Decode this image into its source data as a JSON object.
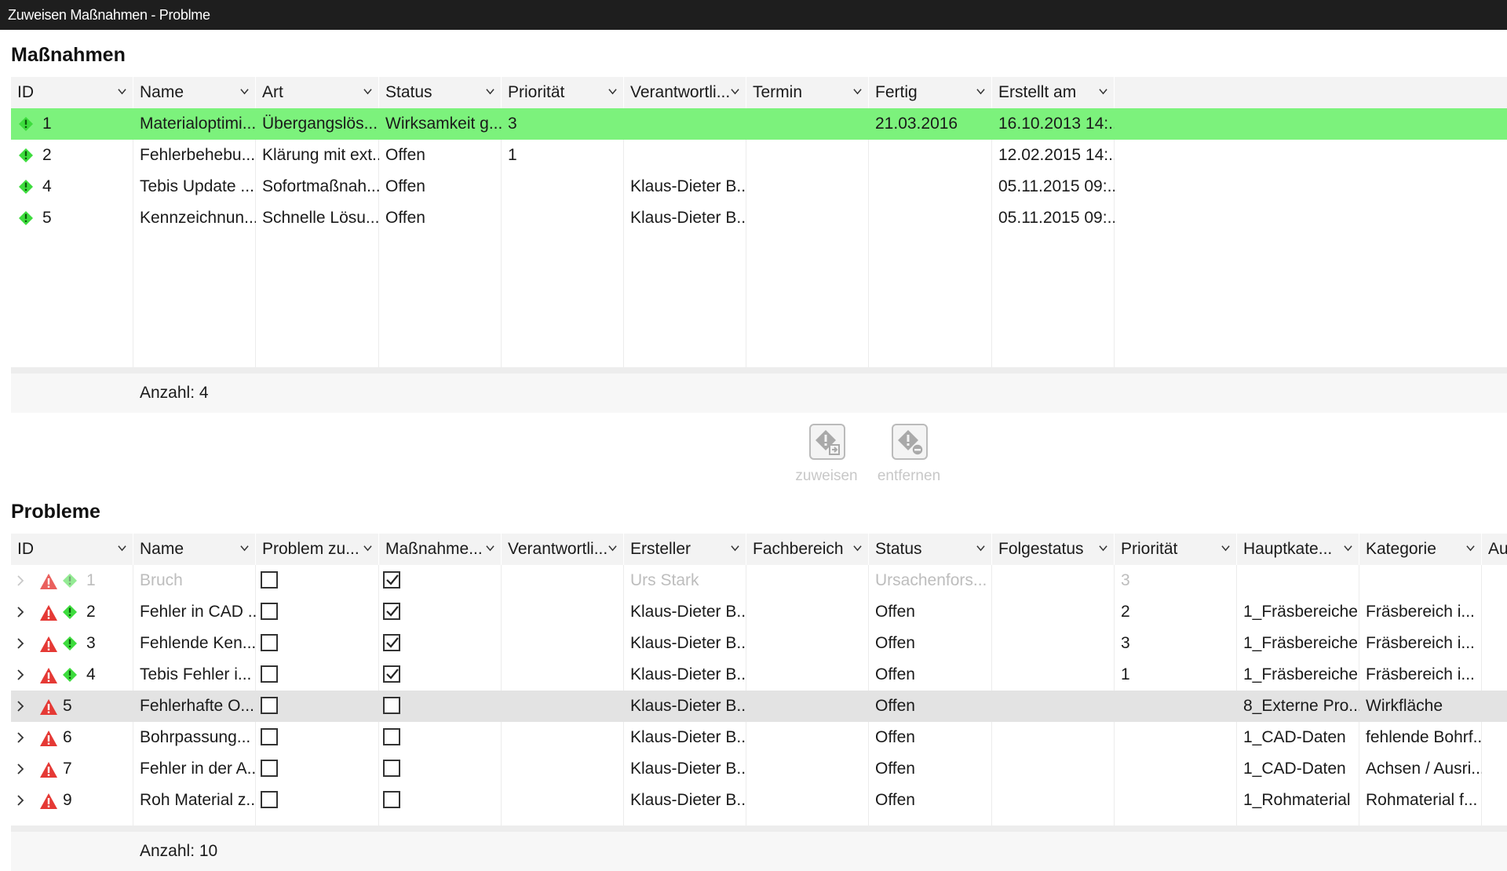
{
  "window": {
    "title": "Zuweisen Maßnahmen - Problme"
  },
  "massnahmen": {
    "title": "Maßnahmen",
    "columns": [
      "ID",
      "Name",
      "Art",
      "Status",
      "Priorität",
      "Verantwortli...",
      "Termin",
      "Fertig",
      "Erstellt am"
    ],
    "rows": [
      {
        "id": "1",
        "name": "Materialoptimi...",
        "art": "Übergangslös...",
        "status": "Wirksamkeit g...",
        "prio": "3",
        "verantw": "",
        "termin": "",
        "fertig": "21.03.2016",
        "erstellt": "16.10.2013 14:...",
        "selected": true
      },
      {
        "id": "2",
        "name": "Fehlerbehebu...",
        "art": "Klärung mit ext...",
        "status": "Offen",
        "prio": "1",
        "verantw": "",
        "termin": "",
        "fertig": "",
        "erstellt": "12.02.2015 14:..."
      },
      {
        "id": "4",
        "name": "Tebis Update ...",
        "art": "Sofortmaßnah...",
        "status": "Offen",
        "prio": "",
        "verantw": "Klaus-Dieter B...",
        "termin": "",
        "fertig": "",
        "erstellt": "05.11.2015 09:..."
      },
      {
        "id": "5",
        "name": "Kennzeichnun...",
        "art": "Schnelle Lösu...",
        "status": "Offen",
        "prio": "",
        "verantw": "Klaus-Dieter B...",
        "termin": "",
        "fertig": "",
        "erstellt": "05.11.2015 09:..."
      }
    ],
    "footer": "Anzahl: 4"
  },
  "actions": {
    "assign": {
      "label": "zuweisen",
      "icon": "assign-measure-icon"
    },
    "remove": {
      "label": "entfernen",
      "icon": "remove-measure-icon"
    }
  },
  "probleme": {
    "title": "Probleme",
    "columns": [
      "ID",
      "Name",
      "Problem zu...",
      "Maßnahme...",
      "Verantwortli...",
      "Ersteller",
      "Fachbereich",
      "Status",
      "Folgestatus",
      "Priorität",
      "Hauptkate...",
      "Kategorie",
      "Au"
    ],
    "rows": [
      {
        "id": "1",
        "name": "Bruch",
        "problem_zu": false,
        "massnahme": true,
        "verantw": "",
        "ersteller": "Urs Stark",
        "fachbereich": "",
        "status": "Ursachenfors...",
        "folgestatus": "",
        "prio": "3",
        "hauptkat": "",
        "kategorie": "",
        "has_measure": true,
        "faded": true
      },
      {
        "id": "2",
        "name": "Fehler in CAD ...",
        "problem_zu": false,
        "massnahme": true,
        "verantw": "",
        "ersteller": "Klaus-Dieter B...",
        "fachbereich": "",
        "status": "Offen",
        "folgestatus": "",
        "prio": "2",
        "hauptkat": "1_Fräsbereiche",
        "kategorie": "Fräsbereich i...",
        "has_measure": true
      },
      {
        "id": "3",
        "name": "Fehlende Ken...",
        "problem_zu": false,
        "massnahme": true,
        "verantw": "",
        "ersteller": "Klaus-Dieter B...",
        "fachbereich": "",
        "status": "Offen",
        "folgestatus": "",
        "prio": "3",
        "hauptkat": "1_Fräsbereiche",
        "kategorie": "Fräsbereich i...",
        "has_measure": true
      },
      {
        "id": "4",
        "name": "Tebis Fehler i...",
        "problem_zu": false,
        "massnahme": true,
        "verantw": "",
        "ersteller": "Klaus-Dieter B...",
        "fachbereich": "",
        "status": "Offen",
        "folgestatus": "",
        "prio": "1",
        "hauptkat": "1_Fräsbereiche",
        "kategorie": "Fräsbereich i...",
        "has_measure": true
      },
      {
        "id": "5",
        "name": "Fehlerhafte O...",
        "problem_zu": false,
        "massnahme": false,
        "verantw": "",
        "ersteller": "Klaus-Dieter B...",
        "fachbereich": "",
        "status": "Offen",
        "folgestatus": "",
        "prio": "",
        "hauptkat": "8_Externe Pro...",
        "kategorie": "Wirkfläche",
        "has_measure": false,
        "selected": true
      },
      {
        "id": "6",
        "name": "Bohrpassung...",
        "problem_zu": false,
        "massnahme": false,
        "verantw": "",
        "ersteller": "Klaus-Dieter B...",
        "fachbereich": "",
        "status": "Offen",
        "folgestatus": "",
        "prio": "",
        "hauptkat": "1_CAD-Daten",
        "kategorie": "fehlende Bohrf...",
        "has_measure": false
      },
      {
        "id": "7",
        "name": "Fehler in der A...",
        "problem_zu": false,
        "massnahme": false,
        "verantw": "",
        "ersteller": "Klaus-Dieter B...",
        "fachbereich": "",
        "status": "Offen",
        "folgestatus": "",
        "prio": "",
        "hauptkat": "1_CAD-Daten",
        "kategorie": "Achsen / Ausri...",
        "has_measure": false
      },
      {
        "id": "9",
        "name": "Roh Material z...",
        "problem_zu": false,
        "massnahme": false,
        "verantw": "",
        "ersteller": "Klaus-Dieter B...",
        "fachbereich": "",
        "status": "Offen",
        "folgestatus": "",
        "prio": "",
        "hauptkat": "1_Rohmaterial",
        "kategorie": "Rohmaterial f...",
        "has_measure": false
      }
    ],
    "footer": "Anzahl: 10"
  },
  "colors": {
    "selected_green": "#7cf27c",
    "selected_gray": "#e3e3e3",
    "diamond_green": "#3ddc3d",
    "warning_red": "#e53935"
  }
}
